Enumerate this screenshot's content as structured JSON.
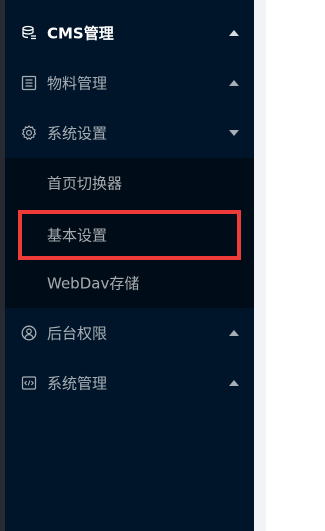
{
  "sidebar": {
    "items": [
      {
        "label": "CMS管理",
        "icon": "database-icon",
        "expanded": false
      },
      {
        "label": "物料管理",
        "icon": "list-icon",
        "expanded": false
      },
      {
        "label": "系统设置",
        "icon": "gear-icon",
        "expanded": true
      },
      {
        "label": "后台权限",
        "icon": "user-circle-icon",
        "expanded": false
      },
      {
        "label": "系统管理",
        "icon": "code-icon",
        "expanded": false
      }
    ],
    "submenu_system_settings": [
      {
        "label": "首页切换器"
      },
      {
        "label": "基本设置"
      },
      {
        "label": "WebDav存储"
      }
    ]
  },
  "colors": {
    "sidebar_bg": "#001529",
    "submenu_bg": "#000c17",
    "highlight_border": "#ef3b3a"
  }
}
